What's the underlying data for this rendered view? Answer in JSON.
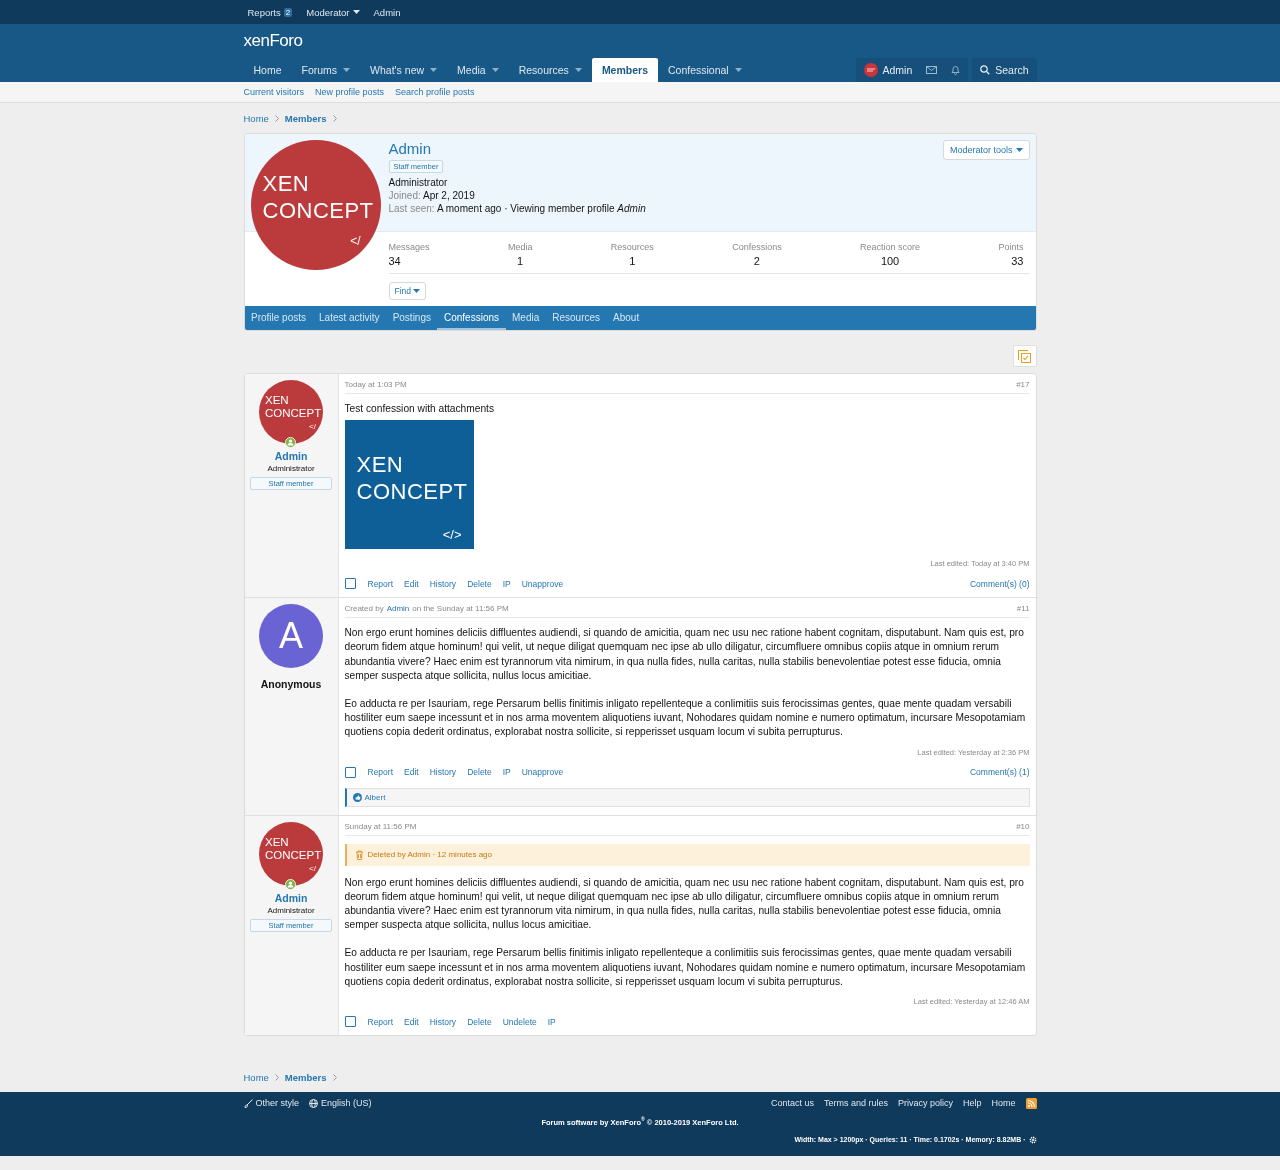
{
  "top_bar": {
    "items": [
      {
        "label": "Reports",
        "badge": "2",
        "dropdown": false
      },
      {
        "label": "Moderator",
        "dropdown": true
      },
      {
        "label": "Admin",
        "dropdown": false
      }
    ]
  },
  "header": {
    "logo": "xenForo",
    "nav": [
      {
        "label": "Home",
        "dropdown": false,
        "selected": false
      },
      {
        "label": "Forums",
        "dropdown": true,
        "selected": false
      },
      {
        "label": "What's new",
        "dropdown": true,
        "selected": false
      },
      {
        "label": "Media",
        "dropdown": true,
        "selected": false
      },
      {
        "label": "Resources",
        "dropdown": true,
        "selected": false
      },
      {
        "label": "Members",
        "dropdown": false,
        "selected": true
      },
      {
        "label": "Confessional",
        "dropdown": true,
        "selected": false
      }
    ],
    "account": {
      "name": "Admin"
    },
    "search": "Search"
  },
  "sub_nav": [
    "Current visitors",
    "New profile posts",
    "Search profile posts"
  ],
  "breadcrumbs_top": [
    {
      "label": "Home",
      "current": false
    },
    {
      "label": "Members",
      "current": true
    }
  ],
  "profile": {
    "avatar": {
      "lines": [
        "XEN",
        "CONCEPT"
      ],
      "code": "</"
    },
    "name": "Admin",
    "badge": "Staff member",
    "title": "Administrator",
    "joined": {
      "label": "Joined:",
      "value": "Apr 2, 2019"
    },
    "last_seen": {
      "label": "Last seen:",
      "value": "A moment ago · Viewing member profile *Admin*"
    },
    "moderator_tools": "Moderator tools",
    "stats": [
      {
        "label": "Messages",
        "value": "34"
      },
      {
        "label": "Media",
        "value": "1"
      },
      {
        "label": "Resources",
        "value": "1"
      },
      {
        "label": "Confessions",
        "value": "2"
      },
      {
        "label": "Reaction score",
        "value": "100"
      },
      {
        "label": "Points",
        "value": "33"
      }
    ],
    "find": "Find",
    "tabs": [
      {
        "label": "Profile posts",
        "selected": false
      },
      {
        "label": "Latest activity",
        "selected": false
      },
      {
        "label": "Postings",
        "selected": false
      },
      {
        "label": "Confessions",
        "selected": true
      },
      {
        "label": "Media",
        "selected": false
      },
      {
        "label": "Resources",
        "selected": false
      },
      {
        "label": "About",
        "selected": false
      }
    ]
  },
  "posts": [
    {
      "author": {
        "avatar": {
          "kind": "logo",
          "lines": [
            "XEN",
            "CONCEPT"
          ],
          "code": "</"
        },
        "online": true,
        "name": "Admin",
        "title": "Administrator",
        "badge": "Staff member"
      },
      "date": [
        {
          "text": "Today at 1:03 PM",
          "link": false
        }
      ],
      "number": "#17",
      "paragraphs": [
        "Test confession with attachments"
      ],
      "attachment": {
        "lines": [
          "XEN",
          "CONCEPT"
        ],
        "code": "</>"
      },
      "last_edited": "Last edited: Today at 3:40 PM",
      "checked": false,
      "actions": [
        "Report",
        "Edit",
        "History",
        "Delete",
        "IP",
        "Unapprove"
      ],
      "comments": "Comment(s) (0)"
    },
    {
      "author": {
        "avatar": {
          "kind": "letter",
          "letter": "A",
          "color": "#6a63d3"
        },
        "online": false,
        "name": "Anonymous"
      },
      "date": [
        {
          "text": "Created by",
          "link": false
        },
        {
          "text": "Admin",
          "link": true
        },
        {
          "text": "on the Sunday at 11:56 PM",
          "link": false
        }
      ],
      "number": "#11",
      "paragraphs": [
        "Non ergo erunt homines deliciis diffluentes audiendi, si quando de amicitia, quam nec usu nec ratione habent cognitam, disputabunt. Nam quis est, pro deorum fidem atque hominum! qui velit, ut neque diligat quemquam nec ipse ab ullo diligatur, circumfluere omnibus copiis atque in omnium rerum abundantia vivere? Haec enim est tyrannorum vita nimirum, in qua nulla fides, nulla caritas, nulla stabilis benevolentiae potest esse fiducia, omnia semper suspecta atque sollicita, nullus locus amicitiae.",
        "Eo adducta re per Isauriam, rege Persarum bellis finitimis inligato repellenteque a conlimitiis suis ferocissimas gentes, quae mente quadam versabili hostiliter eum saepe incessunt et in nos arma moventem aliquotiens iuvant, Nohodares quidam nomine e numero optimatum, incursare Mesopotamiam quotiens copia dederit ordinatus, explorabat nostra sollicite, si repperisset usquam locum vi subita perrupturus."
      ],
      "last_edited": "Last edited: Yesterday at 2:36 PM",
      "checked": false,
      "actions": [
        "Report",
        "Edit",
        "History",
        "Delete",
        "IP",
        "Unapprove"
      ],
      "comments": "Comment(s) (1)",
      "reactions": {
        "name": "Albert"
      }
    },
    {
      "author": {
        "avatar": {
          "kind": "logo",
          "lines": [
            "XEN",
            "CONCEPT"
          ],
          "code": "</"
        },
        "online": true,
        "name": "Admin",
        "title": "Administrator",
        "badge": "Staff member"
      },
      "date": [
        {
          "text": "Sunday at 11:56 PM",
          "link": false
        }
      ],
      "number": "#10",
      "deleted": "Deleted by Admin · 12 minutes ago",
      "paragraphs": [
        "Non ergo erunt homines deliciis diffluentes audiendi, si quando de amicitia, quam nec usu nec ratione habent cognitam, disputabunt. Nam quis est, pro deorum fidem atque hominum! qui velit, ut neque diligat quemquam nec ipse ab ullo diligatur, circumfluere omnibus copiis atque in omnium rerum abundantia vivere? Haec enim est tyrannorum vita nimirum, in qua nulla fides, nulla caritas, nulla stabilis benevolentiae potest esse fiducia, omnia semper suspecta atque sollicita, nullus locus amicitiae.",
        "Eo adducta re per Isauriam, rege Persarum bellis finitimis inligato repellenteque a conlimitiis suis ferocissimas gentes, quae mente quadam versabili hostiliter eum saepe incessunt et in nos arma moventem aliquotiens iuvant, Nohodares quidam nomine e numero optimatum, incursare Mesopotamiam quotiens copia dederit ordinatus, explorabat nostra sollicite, si repperisset usquam locum vi subita perrupturus."
      ],
      "last_edited": "Last edited: Yesterday at 12:46 AM",
      "checked": false,
      "actions": [
        "Report",
        "Edit",
        "History",
        "Delete",
        "Undelete",
        "IP"
      ]
    }
  ],
  "breadcrumbs_bottom": [
    {
      "label": "Home",
      "current": false
    },
    {
      "label": "Members",
      "current": true
    }
  ],
  "footer": {
    "left": [
      {
        "label": "Other style",
        "kind": "style"
      },
      {
        "label": "English (US)",
        "kind": "language"
      }
    ],
    "right": [
      "Contact us",
      "Terms and rules",
      "Privacy policy",
      "Help",
      "Home"
    ],
    "copyright": "Forum software by XenForo$^{®}$ © 2010-2019 XenForo Ltd.",
    "debug": "Width: Max > 1200px · Queries: 11 · Time: 0.1702s · Memory: 8.82MB ·"
  }
}
